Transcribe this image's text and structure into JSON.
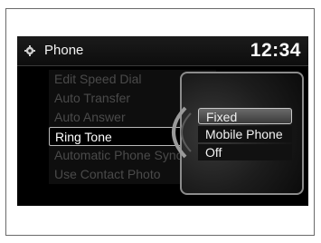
{
  "header": {
    "title": "Phone",
    "time": "12:34"
  },
  "menu": {
    "items": [
      {
        "label": "Edit Speed Dial"
      },
      {
        "label": "Auto Transfer"
      },
      {
        "label": "Auto Answer"
      },
      {
        "label": "Ring Tone"
      },
      {
        "label": "Automatic Phone Sync"
      },
      {
        "label": "Use Contact Photo"
      }
    ],
    "selected_label": "Ring Tone"
  },
  "popup": {
    "options": [
      {
        "label": "Fixed"
      },
      {
        "label": "Mobile Phone"
      },
      {
        "label": "Off"
      }
    ],
    "selected_label": "Fixed"
  }
}
